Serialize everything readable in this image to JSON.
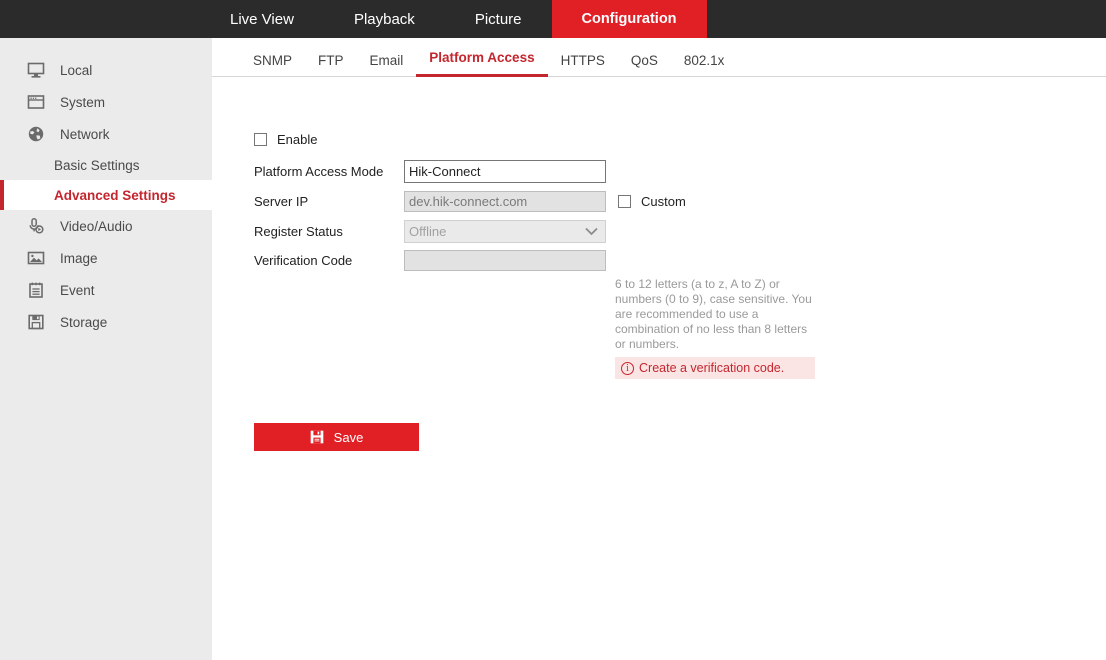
{
  "topnav": {
    "items": [
      {
        "label": "Live View",
        "active": false
      },
      {
        "label": "Playback",
        "active": false
      },
      {
        "label": "Picture",
        "active": false
      },
      {
        "label": "Configuration",
        "active": true
      }
    ]
  },
  "sidebar": {
    "items": [
      {
        "label": "Local",
        "icon": "monitor-icon"
      },
      {
        "label": "System",
        "icon": "window-icon"
      },
      {
        "label": "Network",
        "icon": "globe-icon"
      }
    ],
    "sub_items": [
      {
        "label": "Basic Settings",
        "active": false
      },
      {
        "label": "Advanced Settings",
        "active": true
      }
    ],
    "items_after": [
      {
        "label": "Video/Audio",
        "icon": "microphone-icon"
      },
      {
        "label": "Image",
        "icon": "picture-icon"
      },
      {
        "label": "Event",
        "icon": "clipboard-icon"
      },
      {
        "label": "Storage",
        "icon": "floppy-disk-icon"
      }
    ]
  },
  "tabs": [
    {
      "label": "SNMP",
      "active": false
    },
    {
      "label": "FTP",
      "active": false
    },
    {
      "label": "Email",
      "active": false
    },
    {
      "label": "Platform Access",
      "active": true
    },
    {
      "label": "HTTPS",
      "active": false
    },
    {
      "label": "QoS",
      "active": false
    },
    {
      "label": "802.1x",
      "active": false
    }
  ],
  "form": {
    "enable_label": "Enable",
    "enable_checked": false,
    "platform_access_mode_label": "Platform Access Mode",
    "platform_access_mode_value": "Hik-Connect",
    "platform_access_mode_options": [
      "Hik-Connect"
    ],
    "server_ip_label": "Server IP",
    "server_ip_value": "dev.hik-connect.com",
    "custom_label": "Custom",
    "custom_checked": false,
    "register_status_label": "Register Status",
    "register_status_value": "Offline",
    "register_status_options": [
      "Offline"
    ],
    "verification_code_label": "Verification Code",
    "verification_code_value": "",
    "hint_text": "6 to 12 letters (a to z, A to Z) or numbers (0 to 9), case sensitive. You are recommended to use a combination of no less than 8 letters or numbers.",
    "alert_text": "Create a verification code.",
    "save_label": "Save"
  },
  "colors": {
    "brand_red": "#e12026",
    "dark_header": "#2b2b2b",
    "sidebar_bg": "#ebebeb",
    "active_red_text": "#c4262e",
    "alert_bg": "#fbe4e4"
  }
}
